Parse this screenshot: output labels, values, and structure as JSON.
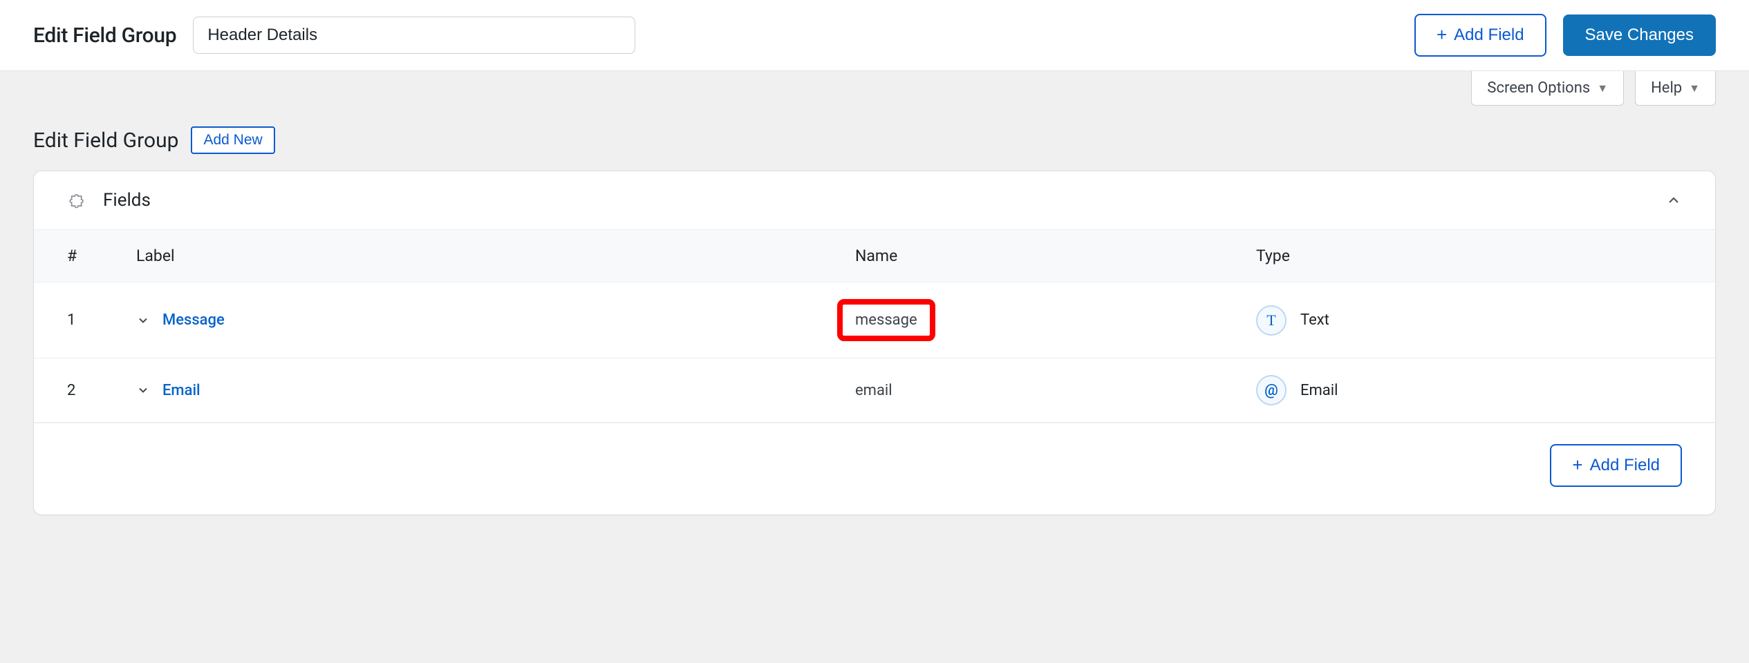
{
  "topbar": {
    "title": "Edit Field Group",
    "title_input_value": "Header Details",
    "add_field": "Add Field",
    "save_changes": "Save Changes"
  },
  "util_tabs": {
    "screen_options": "Screen Options",
    "help": "Help"
  },
  "page": {
    "heading": "Edit Field Group",
    "add_new": "Add New"
  },
  "panel": {
    "title": "Fields"
  },
  "columns": {
    "num": "#",
    "label": "Label",
    "name": "Name",
    "type": "Type"
  },
  "rows": [
    {
      "num": "1",
      "label": "Message",
      "name": "message",
      "type": "Text",
      "type_icon": "T",
      "highlighted": true
    },
    {
      "num": "2",
      "label": "Email",
      "name": "email",
      "type": "Email",
      "type_icon": "@",
      "highlighted": false
    }
  ],
  "footer": {
    "add_field": "Add Field"
  }
}
